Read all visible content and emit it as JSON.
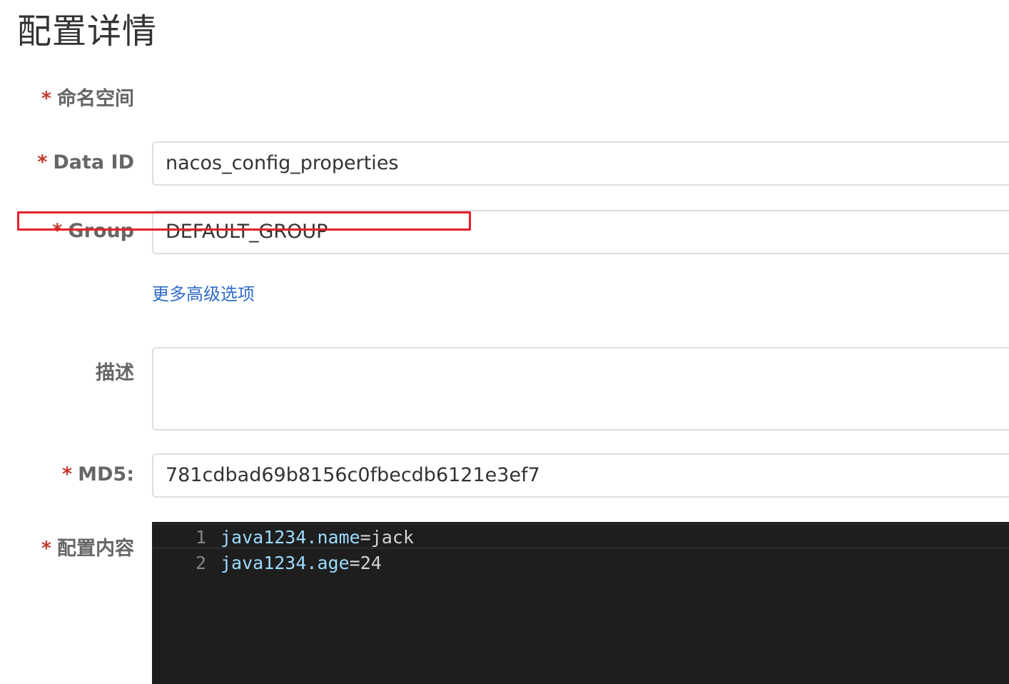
{
  "page": {
    "title": "配置详情"
  },
  "form": {
    "namespace": {
      "label": "命名空间"
    },
    "data_id": {
      "label": "Data ID",
      "value": "nacos_config_properties"
    },
    "group": {
      "label": "Group",
      "value": "DEFAULT_GROUP"
    },
    "advanced_link": "更多高级选项",
    "description": {
      "label": "描述",
      "value": ""
    },
    "md5": {
      "label": "MD5:",
      "value": "781cdbad69b8156c0fbecdb6121e3ef7"
    },
    "content": {
      "label": "配置内容"
    }
  },
  "required_marker": "*",
  "editor": {
    "lines": [
      {
        "num": "1",
        "key": "java1234.name",
        "eq": "=",
        "val": "jack"
      },
      {
        "num": "2",
        "key": "java1234.age",
        "eq": "=",
        "val": "24"
      }
    ]
  },
  "colors": {
    "required": "#c0392b",
    "link": "#2f6cc9",
    "highlight_box": "#e5202b",
    "editor_bg": "#1e1e1e",
    "editor_key": "#9cdcfe"
  }
}
